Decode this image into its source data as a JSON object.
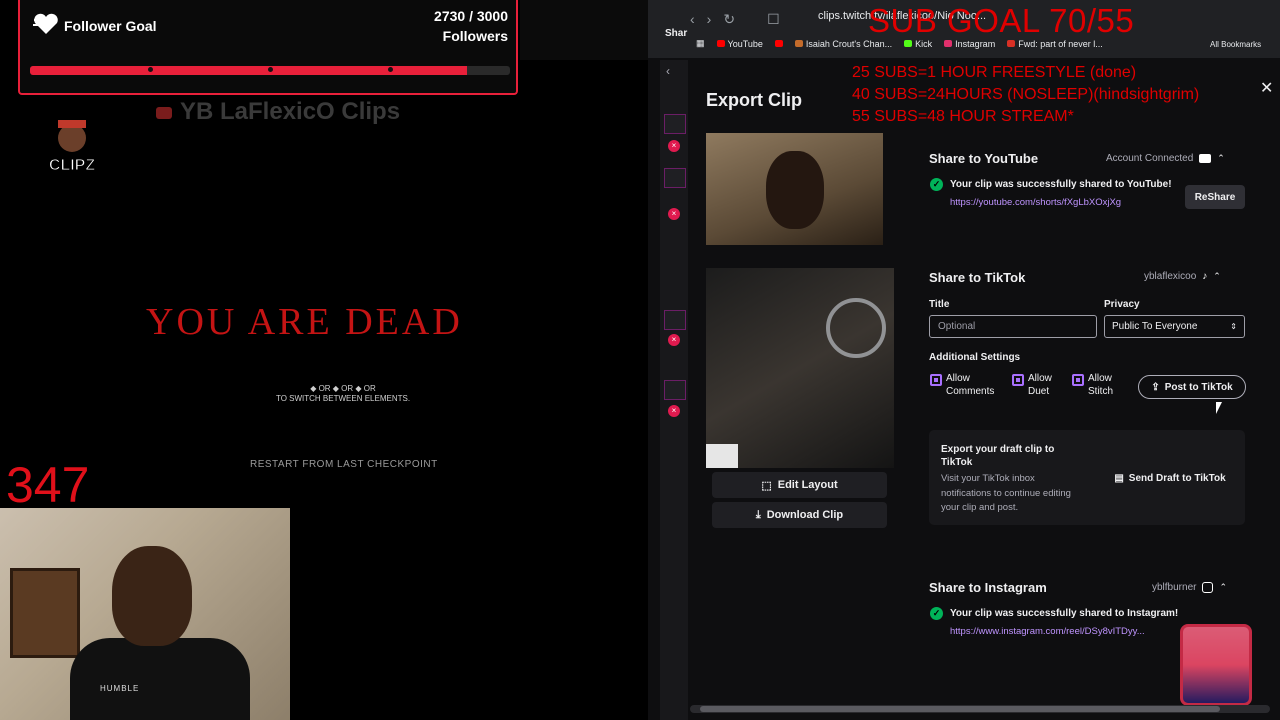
{
  "stream": {
    "follower_goal": {
      "title": "Follower Goal",
      "count": "2730 / 3000",
      "units": "Followers",
      "progress": 0.91,
      "accent": "#e8203a"
    },
    "ghost_channel": "YB LaFlexicO Clips",
    "game": {
      "dead_text": "YOU ARE DEAD",
      "switch_line1": "◆ OR ◆ OR ◆ OR",
      "switch_line2": "TO SWITCH BETWEEN ELEMENTS.",
      "restart": "RESTART FROM LAST CHECKPOINT"
    },
    "counter": "347",
    "webcam_shirt_text": "HUMBLE"
  },
  "browser": {
    "url": "clips.twitch.tv/ilaflexicoo/Nio Noo...",
    "bookmarks": [
      {
        "label": "YouTube",
        "color": "#ff0000"
      },
      {
        "label": "",
        "color": "#ff0000"
      },
      {
        "label": "Isaiah Crout's Chan...",
        "color": "#c46b2b"
      },
      {
        "label": "Kick",
        "color": "#53fc18"
      },
      {
        "label": "Instagram",
        "color": "#e1306c"
      },
      {
        "label": "Fwd: part of never l...",
        "color": "#d93025"
      }
    ],
    "all_bookmarks": "All Bookmarks",
    "side_label": "Shar"
  },
  "overlay": {
    "sub_goal": "SUB GOAL 70/55",
    "lines": [
      "25 SUBS=1 HOUR  FREESTYLE (done)",
      "40 SUBS=24HOURS (NOSLEEP)(hindsightgrim)",
      "55 SUBS=48 HOUR STREAM*"
    ]
  },
  "modal": {
    "title": "Export Clip",
    "edit_layout": "Edit Layout",
    "download_clip": "Download Clip",
    "youtube": {
      "title": "Share to YouTube",
      "status": "Account Connected",
      "success": "Your clip was successfully shared to YouTube!",
      "link": "https://youtube.com/shorts/fXgLbXOxjXg",
      "reshare": "ReShare"
    },
    "tiktok": {
      "title": "Share to TikTok",
      "account": "yblaflexicoo",
      "title_label": "Title",
      "title_placeholder": "Optional",
      "privacy_label": "Privacy",
      "privacy_value": "Public To Everyone",
      "additional": "Additional Settings",
      "options": [
        "Allow Comments",
        "Allow Duet",
        "Allow Stitch"
      ],
      "post": "Post to TikTok",
      "draft_title": "Export your draft clip to TikTok",
      "draft_desc": "Visit your TikTok inbox notifications to continue editing your clip and post.",
      "draft_btn": "Send Draft to TikTok"
    },
    "instagram": {
      "title": "Share to Instagram",
      "account": "yblfburner",
      "success": "Your clip was successfully shared to Instagram!",
      "link": "https://www.instagram.com/reel/DSy8vITDyy..."
    }
  }
}
